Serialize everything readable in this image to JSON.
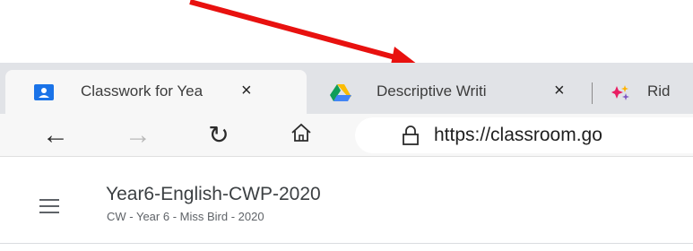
{
  "annotation": {
    "arrow_color": "#e8110f"
  },
  "browser": {
    "tabs": [
      {
        "title": "Classwork for Yea",
        "icon": "classroom-icon",
        "close": "×",
        "active": true
      },
      {
        "title": "Descriptive Writi",
        "icon": "google-drive-icon",
        "close": "×",
        "active": false
      },
      {
        "title": "Rid",
        "icon": "sparkle-app-icon",
        "active": false
      }
    ],
    "toolbar": {
      "back_icon": "←",
      "forward_icon": "→",
      "refresh_icon": "↻",
      "home_icon": "home-icon",
      "lock_icon": "lock-icon",
      "url": "https://classroom.go"
    }
  },
  "classroom": {
    "menu_icon": "hamburger-menu-icon",
    "title": "Year6-English-CWP-2020",
    "subtitle": "CW - Year 6 - Miss Bird - 2020"
  },
  "colors": {
    "tabstrip_bg": "#e1e3e7",
    "active_tab_bg": "#f7f7f7",
    "classroom_icon_blue": "#1a73e8"
  }
}
